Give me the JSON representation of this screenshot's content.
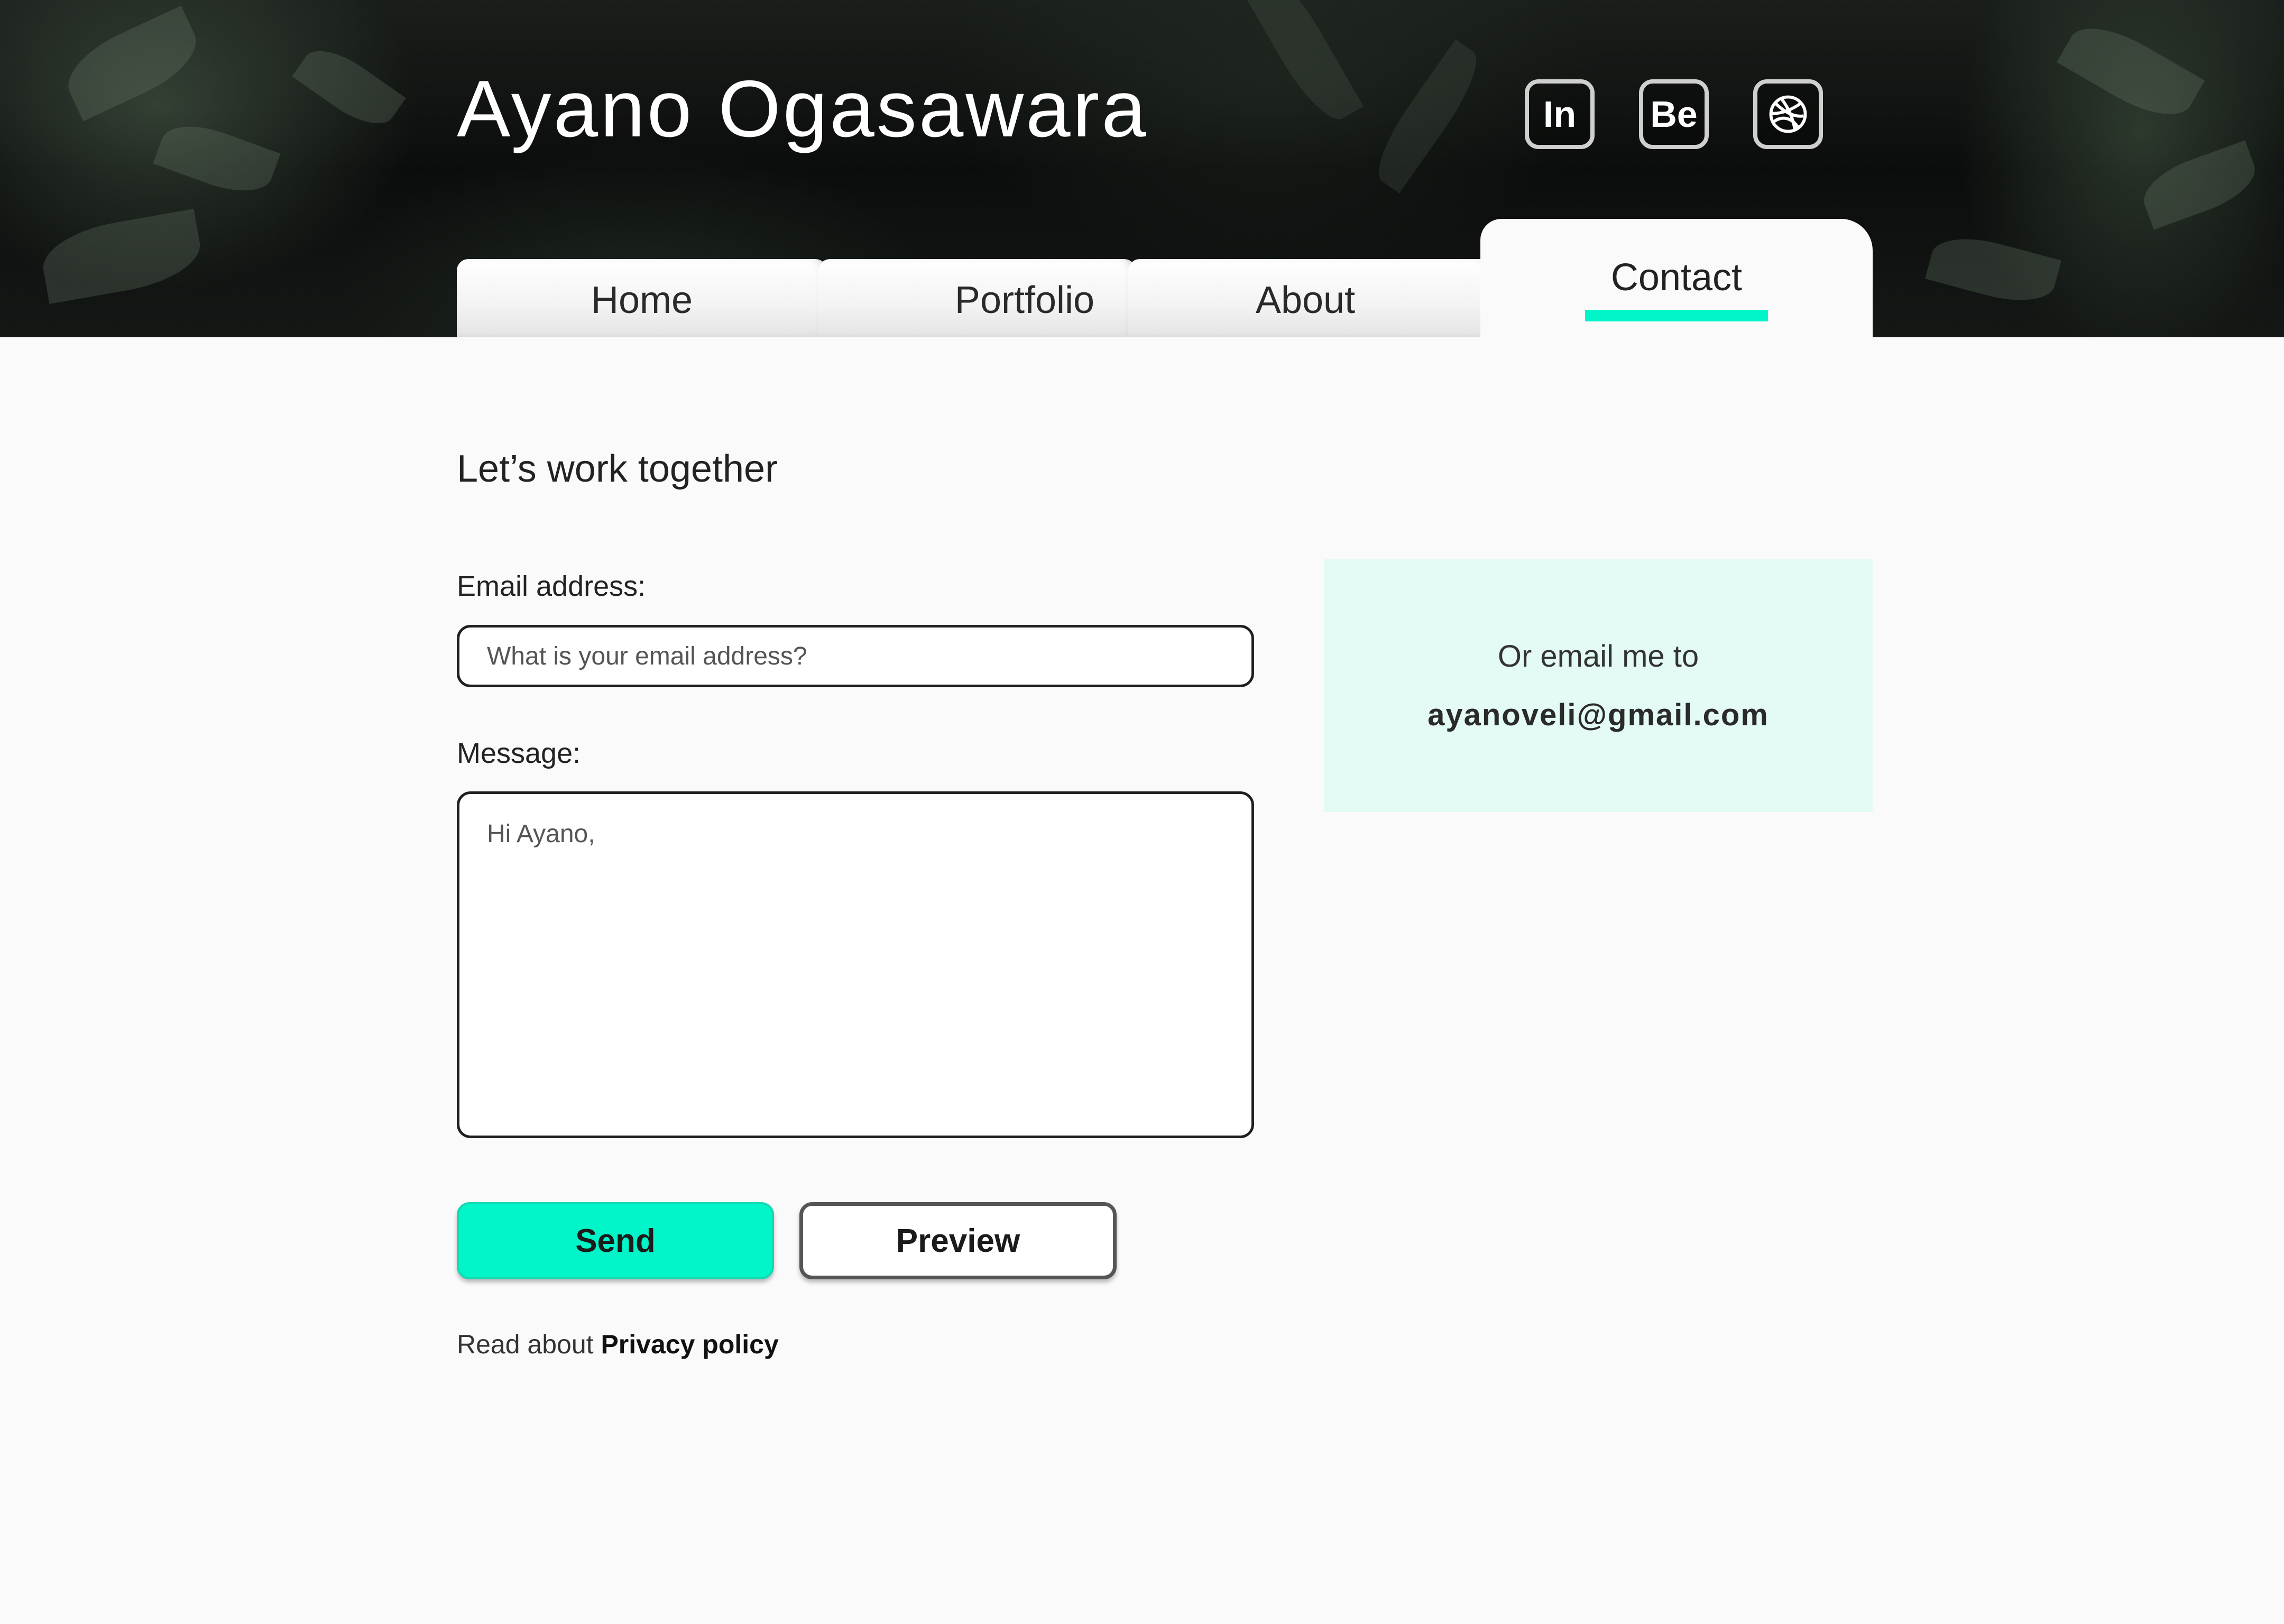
{
  "header": {
    "title": "Ayano Ogasawara",
    "social": [
      {
        "label": "In",
        "icon": "linkedin-icon"
      },
      {
        "label": "Be",
        "icon": "behance-icon"
      },
      {
        "label": "",
        "icon": "dribbble-icon"
      }
    ]
  },
  "nav": {
    "tabs": [
      {
        "label": "Home"
      },
      {
        "label": "Portfolio"
      },
      {
        "label": "About"
      },
      {
        "label": "Contact",
        "active": true
      }
    ]
  },
  "contact": {
    "heading": "Let’s work together",
    "email_label": "Email address:",
    "email_placeholder": "What is your email address?",
    "message_label": "Message:",
    "message_value": "Hi Ayano,",
    "send_label": "Send",
    "preview_label": "Preview",
    "privacy_prefix": "Read about",
    "privacy_link": "Privacy policy"
  },
  "email_card": {
    "intro": "Or email me to",
    "address": "ayanoveli@gmail.com"
  },
  "colors": {
    "accent": "#00f5c8",
    "card_background": "#e3faf5",
    "page_background": "#fafafa"
  }
}
